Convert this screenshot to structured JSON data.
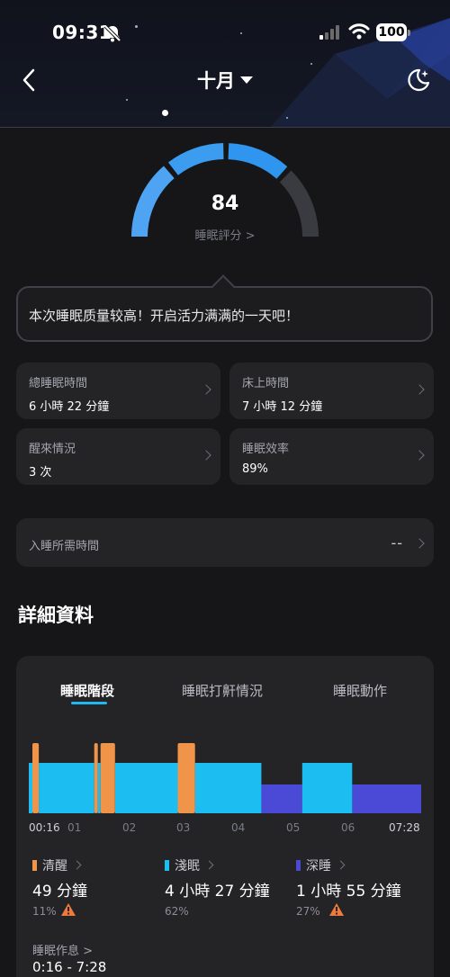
{
  "status_bar": {
    "time": "09:31",
    "battery": "100"
  },
  "nav": {
    "title": "十月",
    "back_icon": "chevron-left-icon",
    "mode_icon": "moon-icon"
  },
  "score": {
    "value": "84",
    "label": "睡眠評分 >",
    "level": 0.84
  },
  "message": "本次睡眠质量较高！开启活力满满的一天吧！",
  "stats": [
    {
      "label": "總睡眠時間",
      "value": "6 小時 22 分鐘"
    },
    {
      "label": "床上時間",
      "value": "7 小時 12 分鐘"
    },
    {
      "label": "醒來情況",
      "value": "3 次"
    },
    {
      "label": "睡眠效率",
      "value": "89%"
    }
  ],
  "latency": {
    "label": "入睡所需時間",
    "value": "--"
  },
  "details": {
    "title": "詳細資料",
    "tabs": [
      "睡眠階段",
      "睡眠打鼾情況",
      "睡眠動作"
    ],
    "active_tab": 0
  },
  "colors": {
    "awake": "#f0944a",
    "light": "#1cbdf0",
    "deep": "#4a4ad6",
    "accent": "#1fb8f0"
  },
  "chart_data": {
    "type": "bar",
    "x_ticks": [
      "00:16",
      "01",
      "02",
      "03",
      "04",
      "05",
      "06",
      "07:28"
    ],
    "x_range": [
      "00:16",
      "07:28"
    ],
    "segments": [
      {
        "stage": "淺眠",
        "start": "00:16",
        "end": "00:20"
      },
      {
        "stage": "清醒",
        "start": "00:20",
        "end": "00:27"
      },
      {
        "stage": "淺眠",
        "start": "00:27",
        "end": "01:28"
      },
      {
        "stage": "清醒",
        "start": "01:28",
        "end": "01:32"
      },
      {
        "stage": "淺眠",
        "start": "01:32",
        "end": "01:35"
      },
      {
        "stage": "清醒",
        "start": "01:35",
        "end": "01:51"
      },
      {
        "stage": "淺眠",
        "start": "01:51",
        "end": "03:00"
      },
      {
        "stage": "清醒",
        "start": "03:00",
        "end": "03:19"
      },
      {
        "stage": "淺眠",
        "start": "03:19",
        "end": "04:32"
      },
      {
        "stage": "深睡",
        "start": "04:32",
        "end": "05:17"
      },
      {
        "stage": "淺眠",
        "start": "05:17",
        "end": "06:12"
      },
      {
        "stage": "深睡",
        "start": "06:12",
        "end": "07:28"
      }
    ]
  },
  "legend": [
    {
      "name": "清醒",
      "duration": "49 分鐘",
      "percent": "11%",
      "warning": true
    },
    {
      "name": "淺眠",
      "duration": "4 小時 27 分鐘",
      "percent": "62%",
      "warning": false
    },
    {
      "name": "深睡",
      "duration": "1 小時 55 分鐘",
      "percent": "27%",
      "warning": true
    }
  ],
  "schedule": {
    "label": "睡眠作息 >",
    "value": "0:16 - 7:28"
  }
}
